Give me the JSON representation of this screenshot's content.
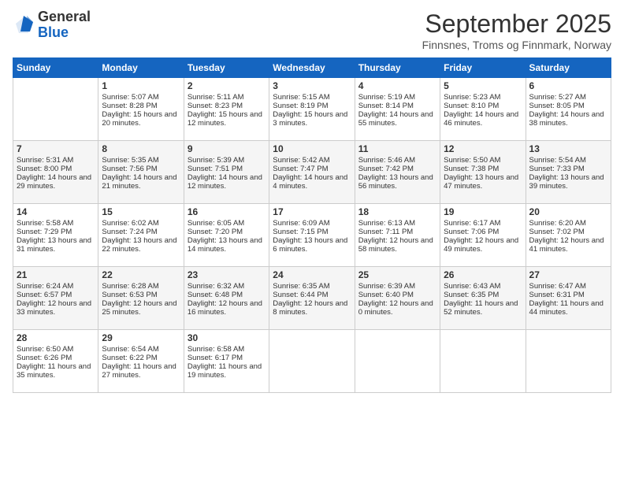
{
  "logo": {
    "general": "General",
    "blue": "Blue"
  },
  "header": {
    "month": "September 2025",
    "location": "Finnsnes, Troms og Finnmark, Norway"
  },
  "days_of_week": [
    "Sunday",
    "Monday",
    "Tuesday",
    "Wednesday",
    "Thursday",
    "Friday",
    "Saturday"
  ],
  "weeks": [
    [
      {
        "day": "",
        "sunrise": "",
        "sunset": "",
        "daylight": ""
      },
      {
        "day": "1",
        "sunrise": "Sunrise: 5:07 AM",
        "sunset": "Sunset: 8:28 PM",
        "daylight": "Daylight: 15 hours and 20 minutes."
      },
      {
        "day": "2",
        "sunrise": "Sunrise: 5:11 AM",
        "sunset": "Sunset: 8:23 PM",
        "daylight": "Daylight: 15 hours and 12 minutes."
      },
      {
        "day": "3",
        "sunrise": "Sunrise: 5:15 AM",
        "sunset": "Sunset: 8:19 PM",
        "daylight": "Daylight: 15 hours and 3 minutes."
      },
      {
        "day": "4",
        "sunrise": "Sunrise: 5:19 AM",
        "sunset": "Sunset: 8:14 PM",
        "daylight": "Daylight: 14 hours and 55 minutes."
      },
      {
        "day": "5",
        "sunrise": "Sunrise: 5:23 AM",
        "sunset": "Sunset: 8:10 PM",
        "daylight": "Daylight: 14 hours and 46 minutes."
      },
      {
        "day": "6",
        "sunrise": "Sunrise: 5:27 AM",
        "sunset": "Sunset: 8:05 PM",
        "daylight": "Daylight: 14 hours and 38 minutes."
      }
    ],
    [
      {
        "day": "7",
        "sunrise": "Sunrise: 5:31 AM",
        "sunset": "Sunset: 8:00 PM",
        "daylight": "Daylight: 14 hours and 29 minutes."
      },
      {
        "day": "8",
        "sunrise": "Sunrise: 5:35 AM",
        "sunset": "Sunset: 7:56 PM",
        "daylight": "Daylight: 14 hours and 21 minutes."
      },
      {
        "day": "9",
        "sunrise": "Sunrise: 5:39 AM",
        "sunset": "Sunset: 7:51 PM",
        "daylight": "Daylight: 14 hours and 12 minutes."
      },
      {
        "day": "10",
        "sunrise": "Sunrise: 5:42 AM",
        "sunset": "Sunset: 7:47 PM",
        "daylight": "Daylight: 14 hours and 4 minutes."
      },
      {
        "day": "11",
        "sunrise": "Sunrise: 5:46 AM",
        "sunset": "Sunset: 7:42 PM",
        "daylight": "Daylight: 13 hours and 56 minutes."
      },
      {
        "day": "12",
        "sunrise": "Sunrise: 5:50 AM",
        "sunset": "Sunset: 7:38 PM",
        "daylight": "Daylight: 13 hours and 47 minutes."
      },
      {
        "day": "13",
        "sunrise": "Sunrise: 5:54 AM",
        "sunset": "Sunset: 7:33 PM",
        "daylight": "Daylight: 13 hours and 39 minutes."
      }
    ],
    [
      {
        "day": "14",
        "sunrise": "Sunrise: 5:58 AM",
        "sunset": "Sunset: 7:29 PM",
        "daylight": "Daylight: 13 hours and 31 minutes."
      },
      {
        "day": "15",
        "sunrise": "Sunrise: 6:02 AM",
        "sunset": "Sunset: 7:24 PM",
        "daylight": "Daylight: 13 hours and 22 minutes."
      },
      {
        "day": "16",
        "sunrise": "Sunrise: 6:05 AM",
        "sunset": "Sunset: 7:20 PM",
        "daylight": "Daylight: 13 hours and 14 minutes."
      },
      {
        "day": "17",
        "sunrise": "Sunrise: 6:09 AM",
        "sunset": "Sunset: 7:15 PM",
        "daylight": "Daylight: 13 hours and 6 minutes."
      },
      {
        "day": "18",
        "sunrise": "Sunrise: 6:13 AM",
        "sunset": "Sunset: 7:11 PM",
        "daylight": "Daylight: 12 hours and 58 minutes."
      },
      {
        "day": "19",
        "sunrise": "Sunrise: 6:17 AM",
        "sunset": "Sunset: 7:06 PM",
        "daylight": "Daylight: 12 hours and 49 minutes."
      },
      {
        "day": "20",
        "sunrise": "Sunrise: 6:20 AM",
        "sunset": "Sunset: 7:02 PM",
        "daylight": "Daylight: 12 hours and 41 minutes."
      }
    ],
    [
      {
        "day": "21",
        "sunrise": "Sunrise: 6:24 AM",
        "sunset": "Sunset: 6:57 PM",
        "daylight": "Daylight: 12 hours and 33 minutes."
      },
      {
        "day": "22",
        "sunrise": "Sunrise: 6:28 AM",
        "sunset": "Sunset: 6:53 PM",
        "daylight": "Daylight: 12 hours and 25 minutes."
      },
      {
        "day": "23",
        "sunrise": "Sunrise: 6:32 AM",
        "sunset": "Sunset: 6:48 PM",
        "daylight": "Daylight: 12 hours and 16 minutes."
      },
      {
        "day": "24",
        "sunrise": "Sunrise: 6:35 AM",
        "sunset": "Sunset: 6:44 PM",
        "daylight": "Daylight: 12 hours and 8 minutes."
      },
      {
        "day": "25",
        "sunrise": "Sunrise: 6:39 AM",
        "sunset": "Sunset: 6:40 PM",
        "daylight": "Daylight: 12 hours and 0 minutes."
      },
      {
        "day": "26",
        "sunrise": "Sunrise: 6:43 AM",
        "sunset": "Sunset: 6:35 PM",
        "daylight": "Daylight: 11 hours and 52 minutes."
      },
      {
        "day": "27",
        "sunrise": "Sunrise: 6:47 AM",
        "sunset": "Sunset: 6:31 PM",
        "daylight": "Daylight: 11 hours and 44 minutes."
      }
    ],
    [
      {
        "day": "28",
        "sunrise": "Sunrise: 6:50 AM",
        "sunset": "Sunset: 6:26 PM",
        "daylight": "Daylight: 11 hours and 35 minutes."
      },
      {
        "day": "29",
        "sunrise": "Sunrise: 6:54 AM",
        "sunset": "Sunset: 6:22 PM",
        "daylight": "Daylight: 11 hours and 27 minutes."
      },
      {
        "day": "30",
        "sunrise": "Sunrise: 6:58 AM",
        "sunset": "Sunset: 6:17 PM",
        "daylight": "Daylight: 11 hours and 19 minutes."
      },
      {
        "day": "",
        "sunrise": "",
        "sunset": "",
        "daylight": ""
      },
      {
        "day": "",
        "sunrise": "",
        "sunset": "",
        "daylight": ""
      },
      {
        "day": "",
        "sunrise": "",
        "sunset": "",
        "daylight": ""
      },
      {
        "day": "",
        "sunrise": "",
        "sunset": "",
        "daylight": ""
      }
    ]
  ]
}
